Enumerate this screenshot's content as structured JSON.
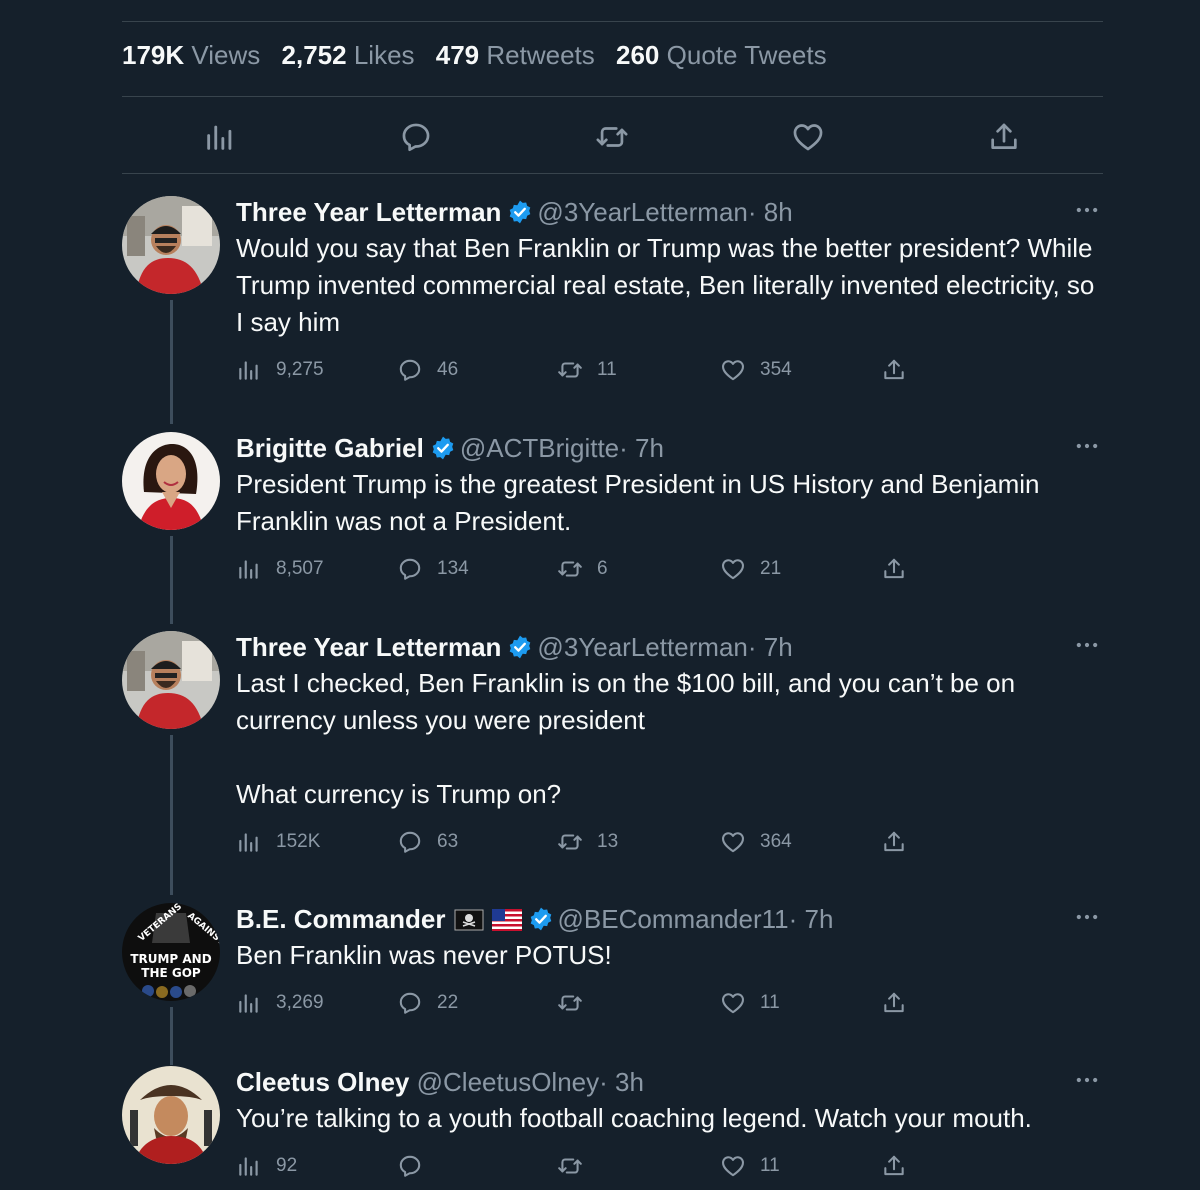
{
  "stats": {
    "views_num": "179K",
    "views_label": "Views",
    "likes_num": "2,752",
    "likes_label": "Likes",
    "retweets_num": "479",
    "retweets_label": "Retweets",
    "quotes_num": "260",
    "quotes_label": "Quote Tweets"
  },
  "action_icons": [
    "views-icon",
    "reply-icon",
    "retweet-icon",
    "like-icon",
    "share-icon"
  ],
  "colors": {
    "background": "#15202b",
    "verified": "#1d9bf0",
    "muted": "#8b98a5",
    "divider": "#38444d"
  },
  "tweets": [
    {
      "name": "Three Year Letterman",
      "handle": "@3YearLetterman",
      "time": "· 8h",
      "text": "Would you say that Ben Franklin or Trump was the better president? While Trump invented commercial real estate, Ben literally invented electricity, so I say him",
      "views": "9,275",
      "replies": "46",
      "retweets": "11",
      "likes": "354"
    },
    {
      "name": "Brigitte Gabriel",
      "handle": "@ACTBrigitte",
      "time": "· 7h",
      "text": "President Trump is the greatest President in US History and Benjamin Franklin was not a President.",
      "views": "8,507",
      "replies": "134",
      "retweets": "6",
      "likes": "21"
    },
    {
      "name": "Three Year Letterman",
      "handle": "@3YearLetterman",
      "time": "· 7h",
      "text": "Last I checked, Ben Franklin is on the $100 bill, and you can’t be on currency unless you were president\n\nWhat currency is Trump on?",
      "views": "152K",
      "replies": "63",
      "retweets": "13",
      "likes": "364"
    },
    {
      "name": "B.E. Commander",
      "handle": "@BECommander11",
      "time": "· 7h",
      "name_emoji": [
        "pirate-flag",
        "us-flag"
      ],
      "avatar_text": {
        "top_left": "VETERANS",
        "top_right": "AGAINST",
        "line1": "TRUMP AND",
        "line2": "THE GOP"
      },
      "text": "Ben Franklin was never POTUS!",
      "views": "3,269",
      "replies": "22",
      "retweets": "",
      "likes": "11"
    },
    {
      "name": "Cleetus Olney",
      "handle": "@CleetusOlney",
      "time": "· 3h",
      "text": "You’re talking to a youth football coaching legend. Watch your mouth.",
      "views": "92",
      "replies": "",
      "retweets": "",
      "likes": "11"
    }
  ]
}
